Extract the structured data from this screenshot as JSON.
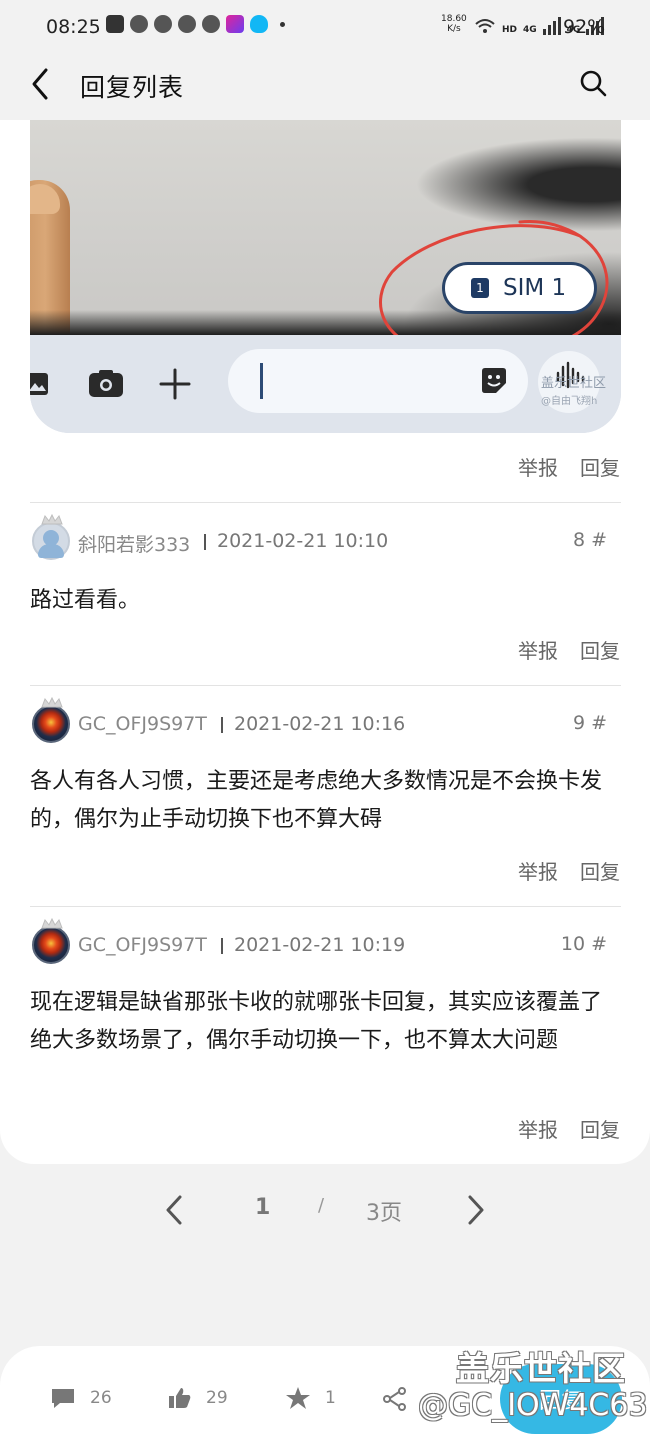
{
  "status_bar": {
    "time": "08:25",
    "net_speed_value": "18.60",
    "net_speed_unit": "K/s",
    "hd_label": "HD",
    "network_1": "4G",
    "network_2": "4G",
    "battery": "92%"
  },
  "header": {
    "title": "回复列表"
  },
  "post_image": {
    "sim_label": "SIM 1",
    "sim_badge": "1",
    "watermark": "盖乐世社区",
    "watermark_sub": "@自由飞翔h"
  },
  "actions": {
    "report": "举报",
    "reply": "回复"
  },
  "replies": [
    {
      "user": "斜阳若影333",
      "time": "2021-02-21 10:10",
      "floor": "8 #",
      "text": "路过看看。"
    },
    {
      "user": "GC_OFJ9S97T",
      "time": "2021-02-21 10:16",
      "floor": "9 #",
      "text": "各人有各人习惯，主要还是考虑绝大多数情况是不会换卡发的，偶尔为止手动切换下也不算大碍"
    },
    {
      "user": "GC_OFJ9S97T",
      "time": "2021-02-21 10:19",
      "floor": "10 #",
      "text": "现在逻辑是缺省那张卡收的就哪张卡回复，其实应该覆盖了绝大多数场景了，偶尔手动切换一下，也不算太大问题"
    }
  ],
  "pager": {
    "current": "1",
    "separator": "/",
    "total": "3页"
  },
  "bottom_bar": {
    "comments": "26",
    "likes": "29",
    "favorites": "1",
    "reply_button": "回复"
  },
  "watermark": {
    "brand": "盖乐世社区",
    "user": "@GC_IOW4C63"
  },
  "colors": {
    "accent": "#35b8e4",
    "background": "#f2f2f2",
    "card": "#ffffff"
  }
}
